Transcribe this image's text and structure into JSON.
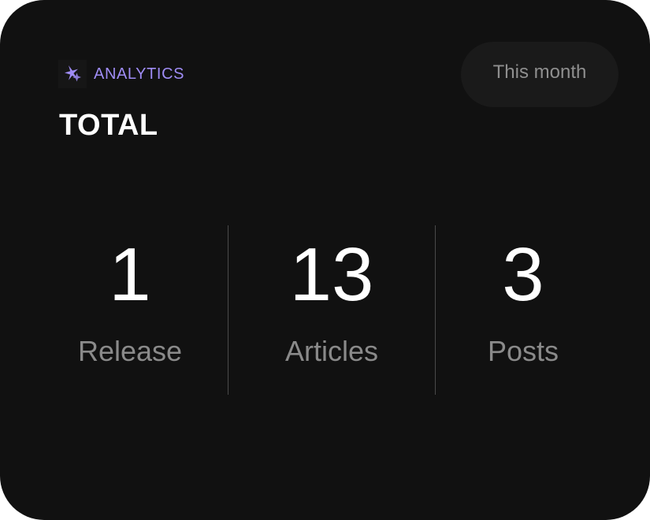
{
  "brand": {
    "icon": "sparkle-icon",
    "label": "ANALYTICS"
  },
  "title": "TOTAL",
  "period_button": {
    "label": "This month"
  },
  "stats": [
    {
      "value": "1",
      "label": "Release"
    },
    {
      "value": "13",
      "label": "Articles"
    },
    {
      "value": "3",
      "label": "Posts"
    }
  ],
  "colors": {
    "background": "#111111",
    "accent": "#9f8cf5",
    "text": "#ffffff",
    "muted": "#8a8a8a"
  }
}
